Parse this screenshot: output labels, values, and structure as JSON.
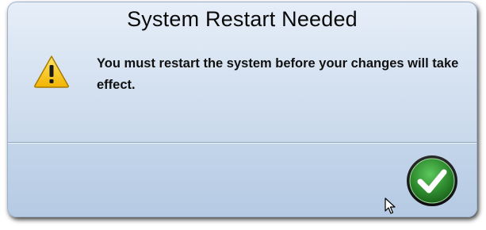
{
  "dialog": {
    "title": "System Restart Needed",
    "message": "You must restart the system before your changes will take effect.",
    "icon": "warning-icon",
    "confirm_icon": "checkmark-icon"
  },
  "colors": {
    "dialog_top": "#e6eef8",
    "dialog_bottom": "#bccfe6",
    "warning_yellow": "#f5c400",
    "confirm_green": "#2e8a2e"
  }
}
